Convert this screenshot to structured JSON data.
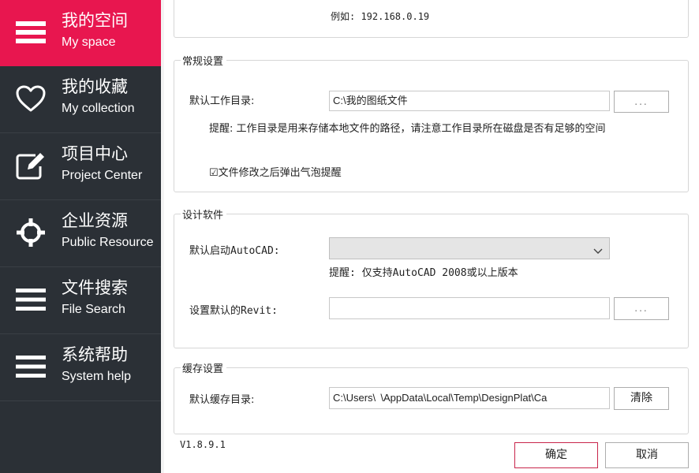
{
  "sidebar": {
    "items": [
      {
        "zh": "我的空间",
        "en": "My space",
        "icon": "menu-icon",
        "active": true
      },
      {
        "zh": "我的收藏",
        "en": "My collection",
        "icon": "heart-icon"
      },
      {
        "zh": "项目中心",
        "en": "Project Center",
        "icon": "edit-icon"
      },
      {
        "zh": "企业资源",
        "en": "Public Resource",
        "icon": "crosshair-icon"
      },
      {
        "zh": "文件搜索",
        "en": "File Search",
        "icon": "menu-icon"
      },
      {
        "zh": "系统帮助",
        "en": "System help",
        "icon": "menu-icon"
      }
    ],
    "active_color": "#e8164f",
    "bg_color": "#2b3036"
  },
  "top_group": {
    "example_text": "例如: 192.168.0.19"
  },
  "general": {
    "legend": "常规设置",
    "work_dir_label": "默认工作目录:",
    "work_dir_value": "C:\\我的图纸文件",
    "browse_label": "...",
    "tip": "提醒: 工作目录是用来存储本地文件的路径，请注意工作目录所在磁盘是否有足够的空间",
    "checkbox_label": "☑文件修改之后弹出气泡提醒"
  },
  "design": {
    "legend": "设计软件",
    "autocad_label": "默认启动AutoCAD:",
    "autocad_value": "",
    "autocad_tip": "提醒: 仅支持AutoCAD 2008或以上版本",
    "revit_label": "设置默认的Revit:",
    "revit_value": "",
    "browse_label": "..."
  },
  "cache": {
    "legend": "缓存设置",
    "dir_label": "默认缓存目录:",
    "dir_value": "C:\\Users\\            \\AppData\\Local\\Temp\\DesignPlat\\Ca",
    "clear_label": "清除"
  },
  "footer": {
    "version": "V1.8.9.1",
    "ok_label": "确定",
    "cancel_label": "取消"
  }
}
